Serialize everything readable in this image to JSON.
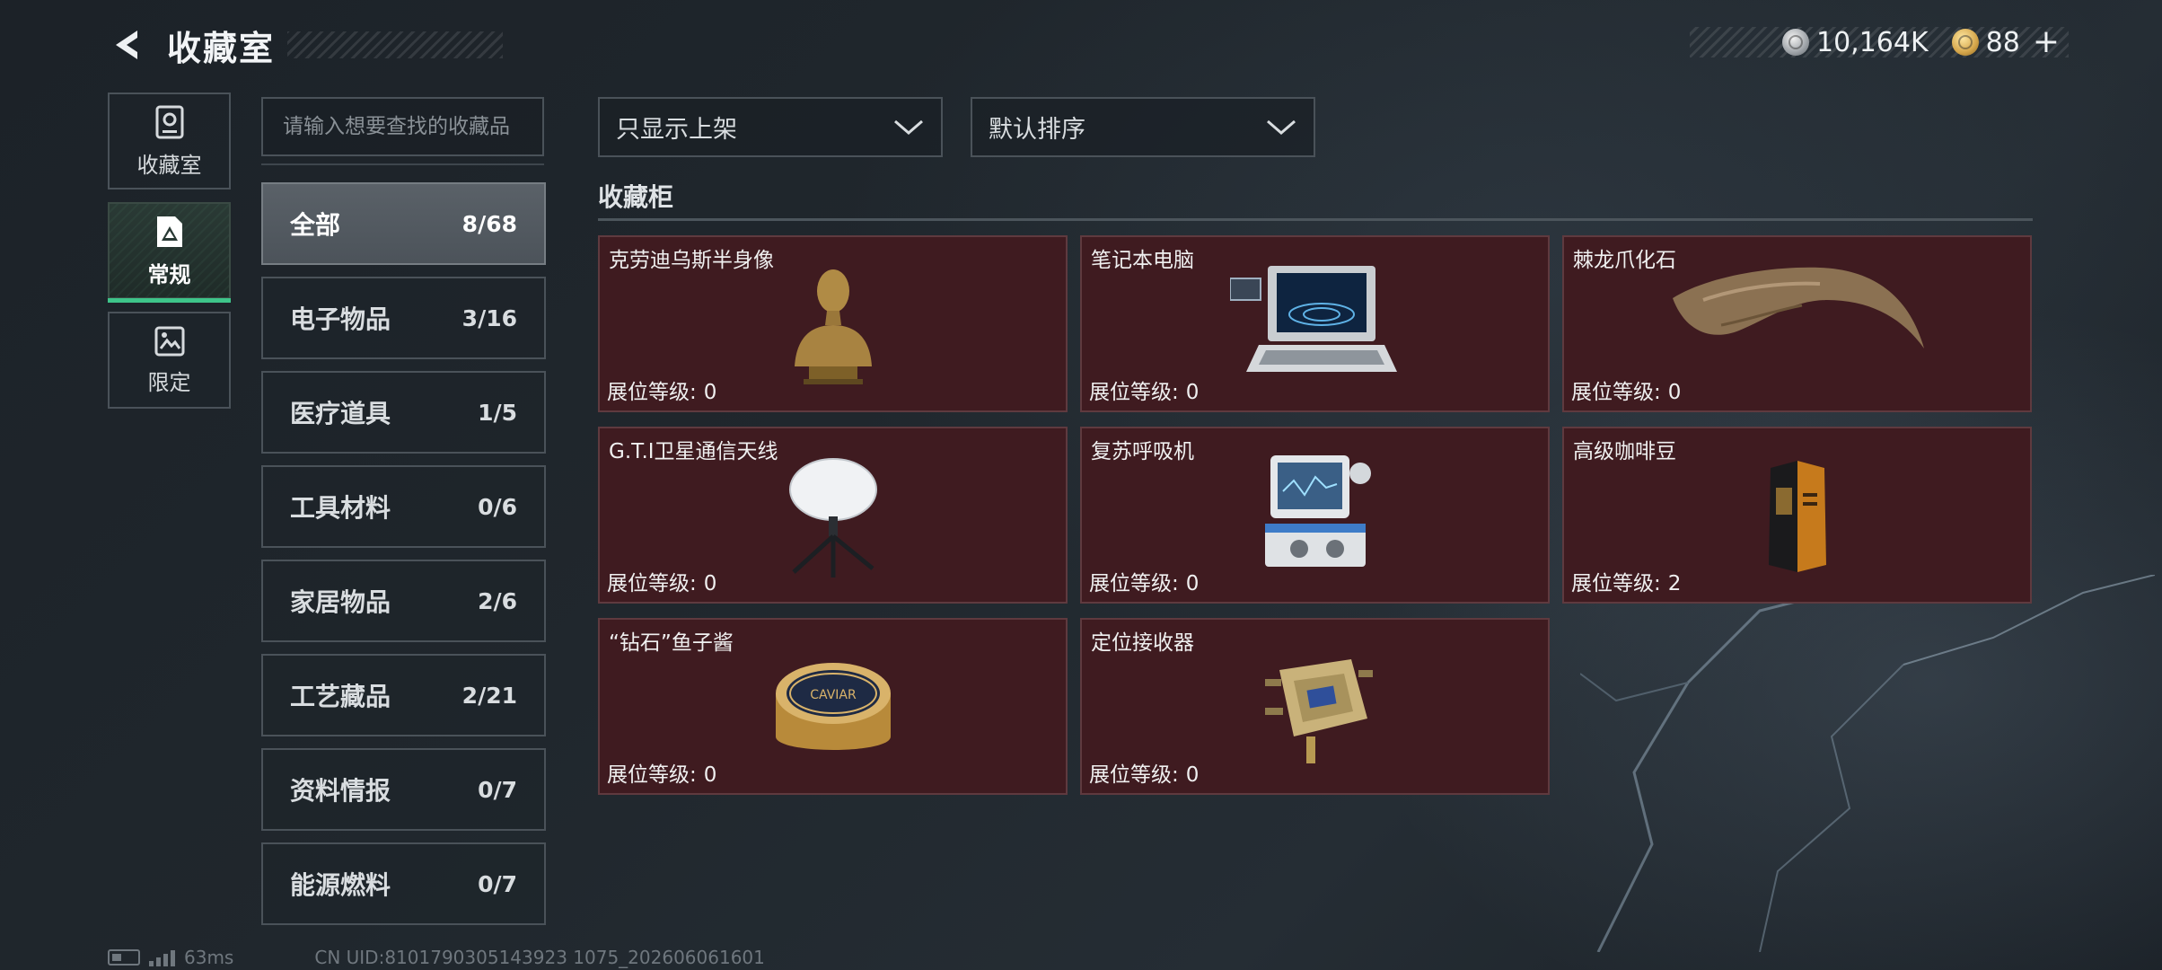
{
  "header": {
    "title": "收藏室",
    "currency": [
      {
        "icon": "silver-coin-icon",
        "value": "10,164K"
      },
      {
        "icon": "gold-coin-icon",
        "value": "88"
      }
    ],
    "plus": "+"
  },
  "side_tabs": [
    {
      "label": "收藏室",
      "icon": "cabinet-icon",
      "active": false
    },
    {
      "label": "常规",
      "icon": "document-triangle-icon",
      "active": true
    },
    {
      "label": "限定",
      "icon": "picture-icon",
      "active": false
    }
  ],
  "search": {
    "placeholder": "请输入想要查找的收藏品"
  },
  "categories": [
    {
      "name": "全部",
      "count": "8/68",
      "active": true
    },
    {
      "name": "电子物品",
      "count": "3/16"
    },
    {
      "name": "医疗道具",
      "count": "1/5"
    },
    {
      "name": "工具材料",
      "count": "0/6"
    },
    {
      "name": "家居物品",
      "count": "2/6"
    },
    {
      "name": "工艺藏品",
      "count": "2/21"
    },
    {
      "name": "资料情报",
      "count": "0/7"
    },
    {
      "name": "能源燃料",
      "count": "0/7"
    }
  ],
  "filters": {
    "listing": "只显示上架",
    "sort": "默认排序"
  },
  "section_title": "收藏柜",
  "level_label": "展位等级:",
  "items": [
    {
      "name": "克劳迪乌斯半身像",
      "level": "0",
      "icon": "bust-icon"
    },
    {
      "name": "笔记本电脑",
      "level": "0",
      "icon": "laptop-icon"
    },
    {
      "name": "棘龙爪化石",
      "level": "0",
      "icon": "claw-fossil-icon"
    },
    {
      "name": "G.T.I卫星通信天线",
      "level": "0",
      "icon": "satellite-dish-icon"
    },
    {
      "name": "复苏呼吸机",
      "level": "0",
      "icon": "ventilator-icon"
    },
    {
      "name": "高级咖啡豆",
      "level": "2",
      "icon": "coffee-bag-icon"
    },
    {
      "name": "“钻石”鱼子酱",
      "level": "0",
      "icon": "caviar-tin-icon",
      "tin_text": "CAVIAR"
    },
    {
      "name": "定位接收器",
      "level": "0",
      "icon": "gps-receiver-icon"
    }
  ],
  "status": {
    "ping": "63ms",
    "uid": "CN UID:8101790305143923 1075_202606061601"
  }
}
